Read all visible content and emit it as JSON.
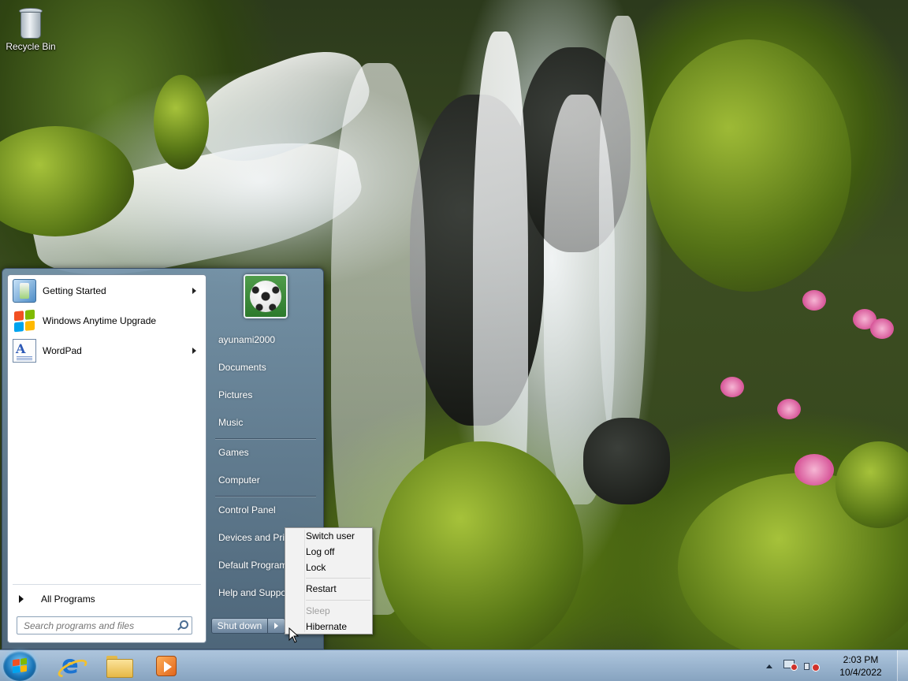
{
  "colors": {
    "taskbar": "#8aa6c2",
    "start_menu_right_pane": "#6f8aa6",
    "menu_bg": "#f2f2f2",
    "windows_flag": [
      "#f25022",
      "#7fba00",
      "#00a4ef",
      "#ffb900"
    ]
  },
  "desktop": {
    "icons": [
      {
        "label": "Recycle Bin",
        "icon": "recycle-bin-icon"
      }
    ]
  },
  "start_menu": {
    "pinned_programs": [
      {
        "label": "Getting Started",
        "icon": "getting-started-icon",
        "has_submenu": true
      },
      {
        "label": "Windows Anytime Upgrade",
        "icon": "windows-logo-icon",
        "has_submenu": false
      },
      {
        "label": "WordPad",
        "icon": "wordpad-icon",
        "has_submenu": true
      }
    ],
    "all_programs_label": "All Programs",
    "search": {
      "placeholder": "Search programs and files",
      "value": ""
    },
    "user_picture": "soccer-ball-icon",
    "right_items": [
      "ayunami2000",
      "Documents",
      "Pictures",
      "Music",
      "Games",
      "Computer",
      "Control Panel",
      "Devices and Printers",
      "Default Programs",
      "Help and Support"
    ],
    "shutdown_label": "Shut down"
  },
  "power_menu": {
    "items": [
      {
        "label": "Switch user",
        "enabled": true
      },
      {
        "label": "Log off",
        "enabled": true
      },
      {
        "label": "Lock",
        "enabled": true
      },
      {
        "label": "Restart",
        "enabled": true
      },
      {
        "label": "Sleep",
        "enabled": false
      },
      {
        "label": "Hibernate",
        "enabled": true
      }
    ]
  },
  "taskbar": {
    "pinned": [
      {
        "name": "Internet Explorer",
        "icon": "internet-explorer-icon"
      },
      {
        "name": "Windows Explorer",
        "icon": "folder-icon"
      },
      {
        "name": "Windows Media Player",
        "icon": "media-player-icon"
      }
    ],
    "clock": {
      "time": "2:03 PM",
      "date": "10/4/2022"
    }
  }
}
